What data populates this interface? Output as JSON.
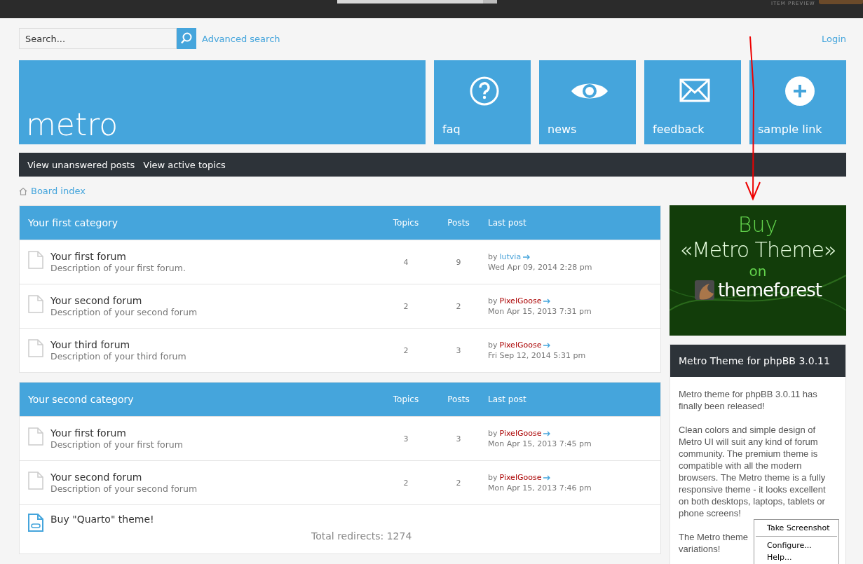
{
  "top_bar": {
    "preview_label": "ITEM PREVIEW"
  },
  "search": {
    "placeholder": "Search...",
    "advanced_link": "Advanced search"
  },
  "login": "Login",
  "logo_tile": "metro",
  "tiles": [
    {
      "label": "faq",
      "kind": "question"
    },
    {
      "label": "news",
      "kind": "eye"
    },
    {
      "label": "feedback",
      "kind": "mail"
    },
    {
      "label": "sample link",
      "kind": "plus"
    }
  ],
  "nav": [
    "View unanswered posts",
    "View active topics"
  ],
  "breadcrumb": "Board index",
  "categories": [
    {
      "title": "Your first category",
      "columns": [
        "Topics",
        "Posts",
        "Last post"
      ],
      "forums": [
        {
          "kind": "forum",
          "name": "Your first forum",
          "description": "Description of your first forum.",
          "topics": "4",
          "posts": "9",
          "by": "by",
          "author": {
            "name": "lutvia",
            "color": "#4aa3d9"
          },
          "date": "Wed Apr 09, 2014 2:28 pm"
        },
        {
          "kind": "forum",
          "name": "Your second forum",
          "description": "Description of your second forum",
          "topics": "2",
          "posts": "2",
          "by": "by",
          "author": {
            "name": "PixelGoose",
            "color": "#aa0000"
          },
          "date": "Mon Apr 15, 2013 7:31 pm"
        },
        {
          "kind": "forum",
          "name": "Your third forum",
          "description": "Description of your third forum",
          "topics": "2",
          "posts": "3",
          "by": "by",
          "author": {
            "name": "PixelGoose",
            "color": "#aa0000"
          },
          "date": "Fri Sep 12, 2014 5:31 pm"
        }
      ]
    },
    {
      "title": "Your second category",
      "columns": [
        "Topics",
        "Posts",
        "Last post"
      ],
      "forums": [
        {
          "kind": "forum",
          "name": "Your first forum",
          "description": "Description of your first forum",
          "topics": "3",
          "posts": "3",
          "by": "by",
          "author": {
            "name": "PixelGoose",
            "color": "#aa0000"
          },
          "date": "Mon Apr 15, 2013 7:45 pm"
        },
        {
          "kind": "forum",
          "name": "Your second forum",
          "description": "Description of your second forum",
          "topics": "2",
          "posts": "2",
          "by": "by",
          "author": {
            "name": "PixelGoose",
            "color": "#aa0000"
          },
          "date": "Mon Apr 15, 2013 7:46 pm"
        },
        {
          "kind": "link",
          "name": "Buy \"Quarto\" theme!",
          "redirects": "Total redirects: 1274"
        }
      ]
    }
  ],
  "banner": {
    "line1": "Buy",
    "line2": "«Metro Theme»",
    "line3": "on",
    "brand": "themeforest"
  },
  "sidebar_box": {
    "title": "Metro Theme for phpBB 3.0.11",
    "paragraphs": [
      "Metro theme for phpBB 3.0.11 has finally been released!",
      "Clean colors and simple design of Metro UI will suit any kind of forum community. The premium theme is compatible with all the modern browsers. The Metro theme is a fully responsive theme - it looks excellent on both desktops, laptops, tablets or phone screens!",
      "The Metro theme",
      "variations!"
    ]
  },
  "context_menu": [
    "Take Screenshot",
    "Configure...",
    "Help..."
  ]
}
